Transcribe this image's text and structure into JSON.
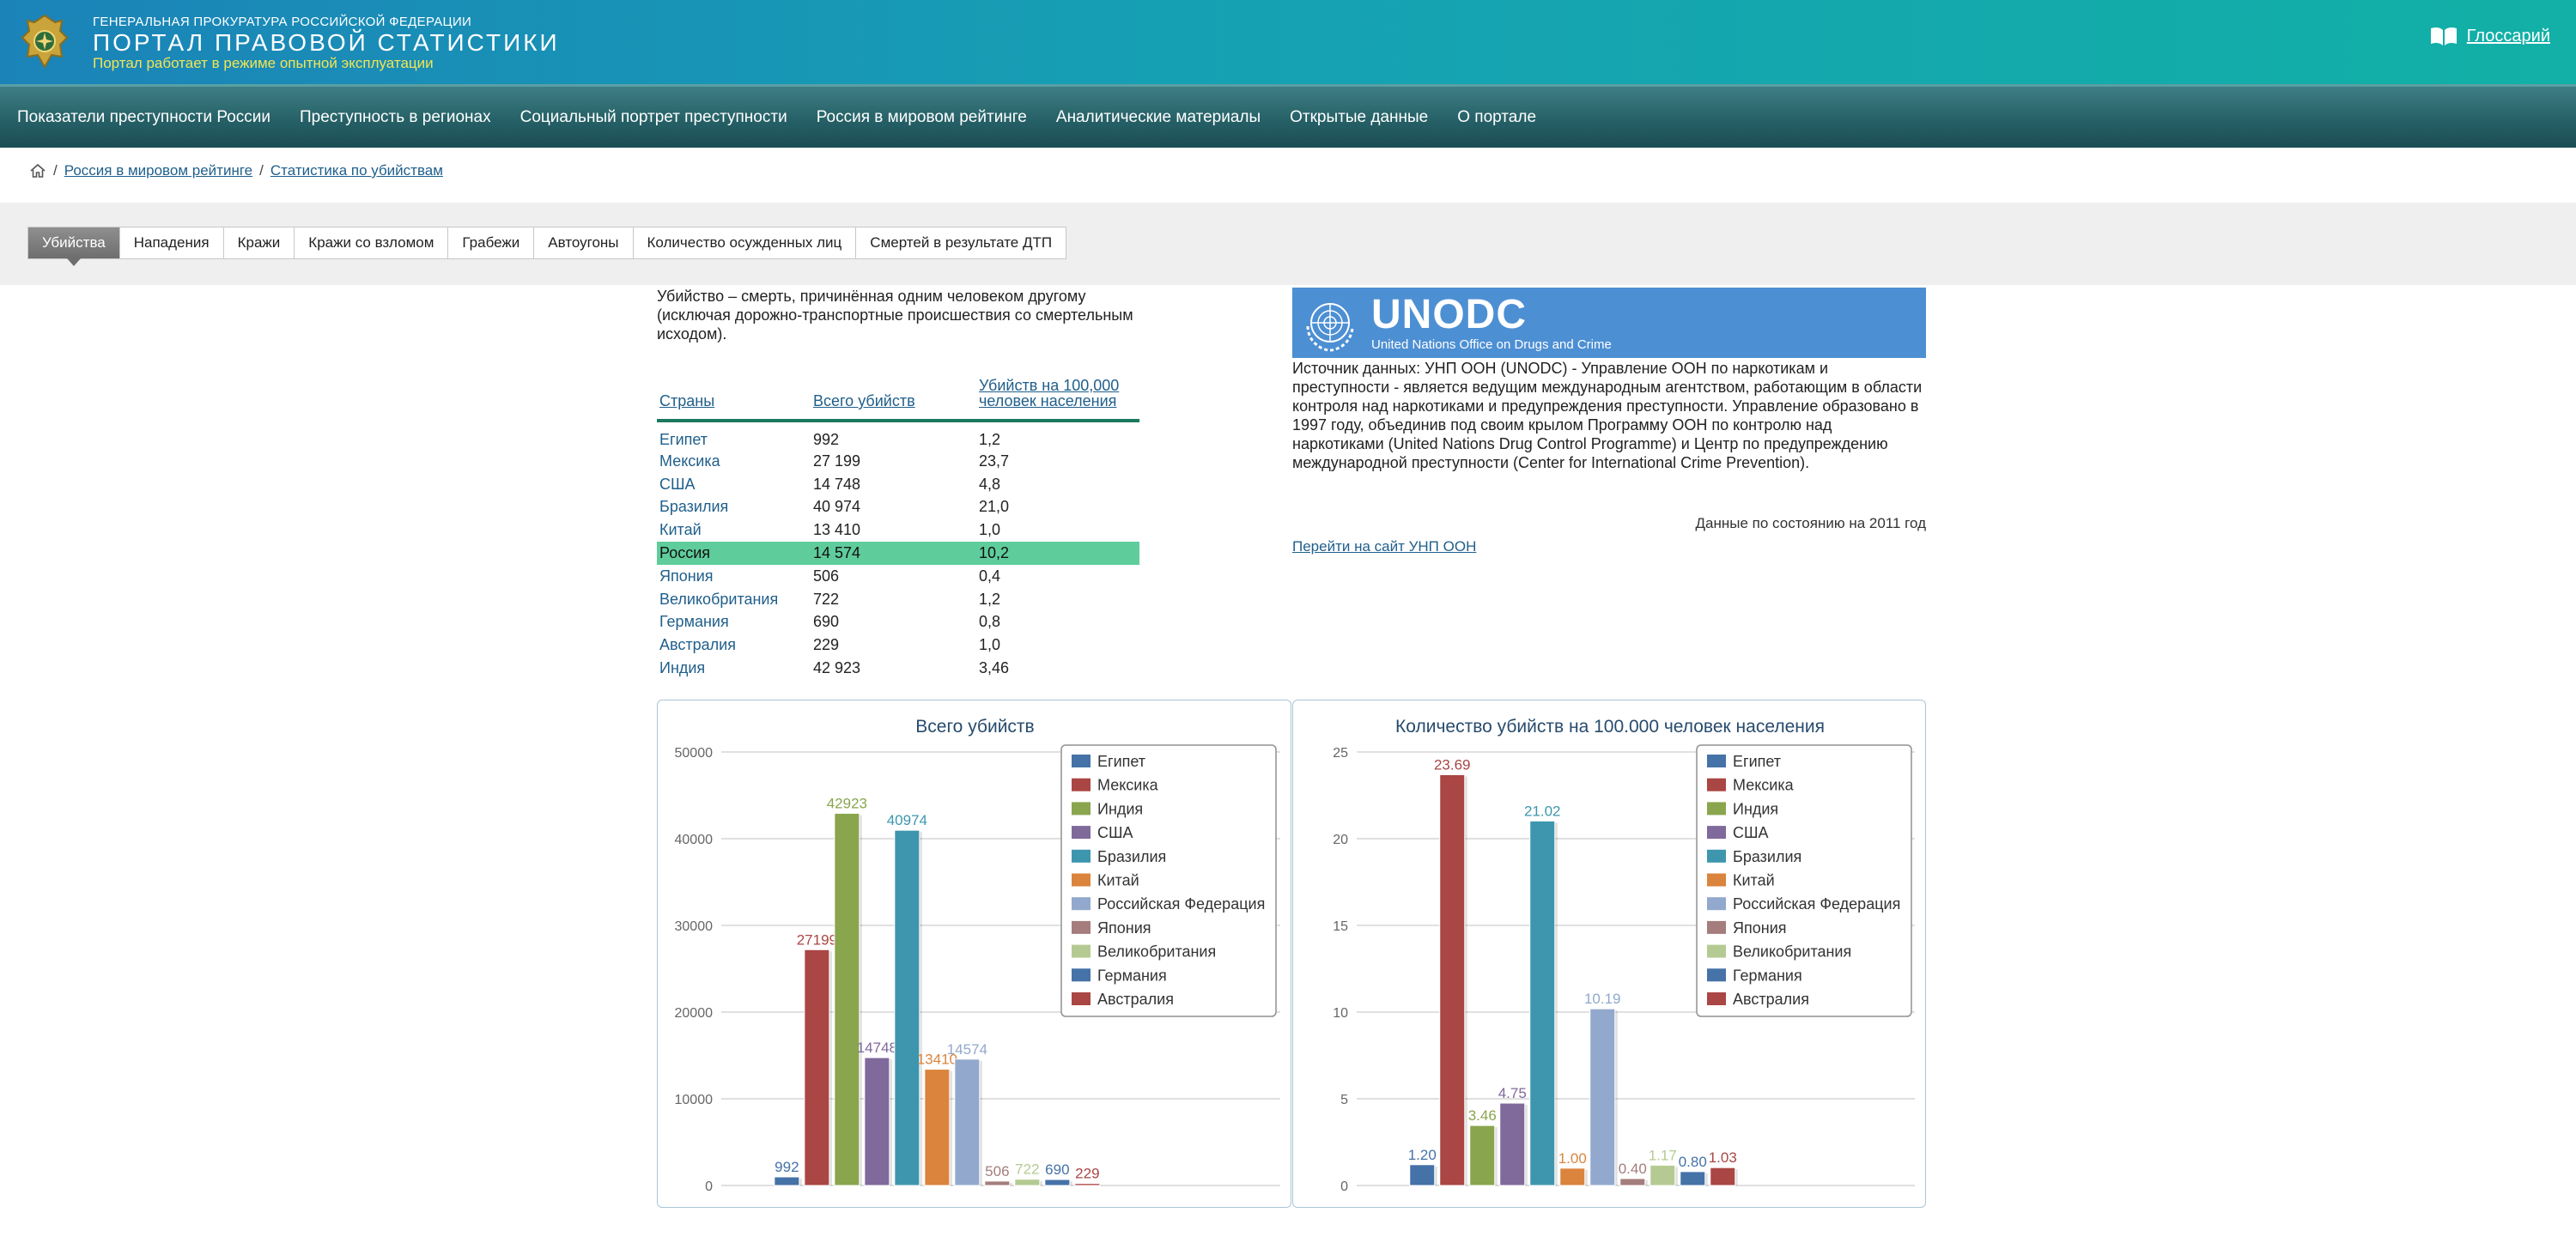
{
  "header": {
    "org": "ГЕНЕРАЛЬНАЯ ПРОКУРАТУРА РОССИЙСКОЙ ФЕДЕРАЦИИ",
    "title": "ПОРТАЛ ПРАВОВОЙ СТАТИСТИКИ",
    "subtitle": "Портал работает в режиме опытной эксплуатации",
    "glossary": "Глоссарий"
  },
  "nav": [
    "Показатели преступности России",
    "Преступность в регионах",
    "Социальный портрет преступности",
    "Россия в мировом рейтинге",
    "Аналитические материалы",
    "Открытые данные",
    "О портале"
  ],
  "breadcrumb": {
    "sep": "/",
    "items": [
      "Россия в мировом рейтинге",
      "Статистика по убийствам"
    ]
  },
  "tabs": [
    "Убийства",
    "Нападения",
    "Кражи",
    "Кражи со взломом",
    "Грабежи",
    "Автоугоны",
    "Количество осужденных лиц",
    "Смертей в результате ДТП"
  ],
  "active_tab": 0,
  "definition": "Убийство – смерть, причинённая одним человеком другому (исключая дорожно-транспортные происшествия со смертельным исходом).",
  "table": {
    "headers": [
      "Страны",
      "Всего убийств",
      "Убийств на 100,000 человек населения"
    ],
    "rows": [
      [
        "Египет",
        "992",
        "1,2"
      ],
      [
        "Мексика",
        "27 199",
        "23,7"
      ],
      [
        "США",
        "14 748",
        "4,8"
      ],
      [
        "Бразилия",
        "40 974",
        "21,0"
      ],
      [
        "Китай",
        "13 410",
        "1,0"
      ],
      [
        "Россия",
        "14 574",
        "10,2"
      ],
      [
        "Япония",
        "506",
        "0,4"
      ],
      [
        "Великобритания",
        "722",
        "1,2"
      ],
      [
        "Германия",
        "690",
        "0,8"
      ],
      [
        "Австралия",
        "229",
        "1,0"
      ],
      [
        "Индия",
        "42 923",
        "3,46"
      ]
    ],
    "highlight_row": 5,
    "highlight_color": "#5fcc9c"
  },
  "unodc": {
    "logo_text": "UNODC",
    "logo_subtext": "United Nations Office on Drugs and Crime",
    "source": "Источник данных: УНП ООН (UNODC) - Управление ООН по наркотикам и преступности - является ведущим международным агентством, работающим в области контроля над наркотиками и предупреждения преступности. Управление образовано в 1997 году, объединив под своим крылом Программу ООН по контролю над наркотиками (United Nations Drug Control Programme) и Центр по предупреждению международной преступности (Center for International Crime Prevention).",
    "as_of": "Данные по состоянию на 2011 год",
    "link": "Перейти на сайт УНП ООН"
  },
  "chart_data": [
    {
      "type": "bar",
      "title": "Всего убийств",
      "ylim": [
        0,
        50000
      ],
      "yticks": [
        0,
        10000,
        20000,
        30000,
        40000,
        50000
      ],
      "grid": true,
      "legend_position": "top-right",
      "legend": [
        "Египет",
        "Мексика",
        "Индия",
        "США",
        "Бразилия",
        "Китай",
        "Российская Федерация",
        "Япония",
        "Великобритания",
        "Германия",
        "Австралия"
      ],
      "series": [
        {
          "name": "Египет",
          "value": 992,
          "label": "992",
          "color": "#4572a7"
        },
        {
          "name": "Мексика",
          "value": 27199,
          "label": "27199",
          "color": "#aa4643"
        },
        {
          "name": "Индия",
          "value": 42923,
          "label": "42923",
          "color": "#89a54e"
        },
        {
          "name": "США",
          "value": 14748,
          "label": "14748",
          "color": "#80699b"
        },
        {
          "name": "Бразилия",
          "value": 40974,
          "label": "40974",
          "color": "#3d96ae"
        },
        {
          "name": "Китай",
          "value": 13410,
          "label": "13410",
          "color": "#db843d"
        },
        {
          "name": "Российская Федерация",
          "value": 14574,
          "label": "14574",
          "color": "#92a8cd"
        },
        {
          "name": "Япония",
          "value": 506,
          "label": "506",
          "color": "#a47d7c"
        },
        {
          "name": "Великобритания",
          "value": 722,
          "label": "722",
          "color": "#b5ca92"
        },
        {
          "name": "Германия",
          "value": 690,
          "label": "690",
          "color": "#4572a7"
        },
        {
          "name": "Австралия",
          "value": 229,
          "label": "229",
          "color": "#aa4643"
        }
      ]
    },
    {
      "type": "bar",
      "title": "Количество убийств на 100.000 человек населения",
      "ylim": [
        0,
        25
      ],
      "yticks": [
        0,
        5,
        10,
        15,
        20,
        25
      ],
      "grid": true,
      "legend_position": "top-right",
      "legend": [
        "Египет",
        "Мексика",
        "Индия",
        "США",
        "Бразилия",
        "Китай",
        "Российская Федерация",
        "Япония",
        "Великобритания",
        "Германия",
        "Австралия"
      ],
      "series": [
        {
          "name": "Египет",
          "value": 1.2,
          "label": "1.20",
          "color": "#4572a7"
        },
        {
          "name": "Мексика",
          "value": 23.69,
          "label": "23.69",
          "color": "#aa4643"
        },
        {
          "name": "Индия",
          "value": 3.46,
          "label": "3.46",
          "color": "#89a54e"
        },
        {
          "name": "США",
          "value": 4.75,
          "label": "4.75",
          "color": "#80699b"
        },
        {
          "name": "Бразилия",
          "value": 21.02,
          "label": "21.02",
          "color": "#3d96ae"
        },
        {
          "name": "Китай",
          "value": 1.0,
          "label": "1.00",
          "color": "#db843d"
        },
        {
          "name": "Российская Федерация",
          "value": 10.19,
          "label": "10.19",
          "color": "#92a8cd"
        },
        {
          "name": "Япония",
          "value": 0.4,
          "label": "0.40",
          "color": "#a47d7c"
        },
        {
          "name": "Великобритания",
          "value": 1.17,
          "label": "1.17",
          "color": "#b5ca92"
        },
        {
          "name": "Германия",
          "value": 0.8,
          "label": "0.80",
          "color": "#4572a7"
        },
        {
          "name": "Австралия",
          "value": 1.03,
          "label": "1.03",
          "color": "#aa4643"
        }
      ]
    }
  ]
}
